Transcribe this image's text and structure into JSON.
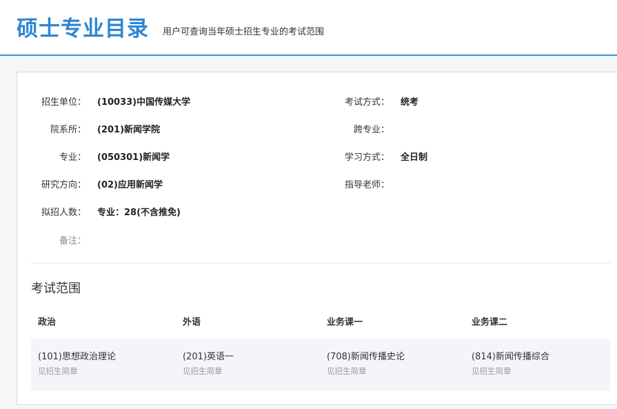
{
  "header": {
    "title": "硕士专业目录",
    "subtitle": "用户可查询当年硕士招生专业的考试范围"
  },
  "fields": {
    "unit": {
      "label": "招生单位：",
      "value": "(10033)中国传媒大学"
    },
    "exam_method": {
      "label": "考试方式：",
      "value": "统考"
    },
    "department": {
      "label": "院系所：",
      "value": "(201)新闻学院"
    },
    "cross_major": {
      "label": "跨专业：",
      "value": ""
    },
    "major": {
      "label": "专业：",
      "value": "(050301)新闻学"
    },
    "study_mode": {
      "label": "学习方式：",
      "value": "全日制"
    },
    "research_direction": {
      "label": "研究方向：",
      "value": "(02)应用新闻学"
    },
    "advisor": {
      "label": "指导老师：",
      "value": ""
    },
    "planned_enrollment": {
      "label": "拟招人数：",
      "value": "专业：28(不含推免)"
    },
    "remarks": {
      "label": "备注：",
      "value": ""
    }
  },
  "exam_scope": {
    "title": "考试范围",
    "columns": [
      "政治",
      "外语",
      "业务课一",
      "业务课二"
    ],
    "rows": [
      {
        "cells": [
          {
            "subject": "(101)思想政治理论",
            "note": "见招生简章"
          },
          {
            "subject": "(201)英语一",
            "note": "见招生简章"
          },
          {
            "subject": "(708)新闻传播史论",
            "note": "见招生简章"
          },
          {
            "subject": "(814)新闻传播综合",
            "note": "见招生简章"
          }
        ]
      }
    ]
  },
  "colors": {
    "accent": "#2f86d3",
    "header_border": "#3b8ed3",
    "table_row_bg": "#f3f5f8"
  }
}
